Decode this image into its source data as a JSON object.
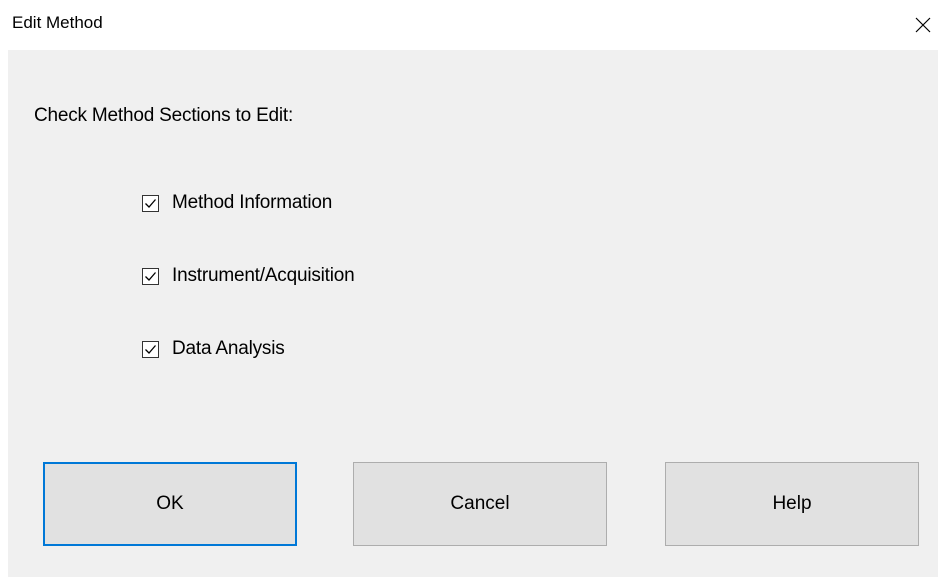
{
  "window": {
    "title": "Edit Method",
    "close_glyph": "✕"
  },
  "dialog": {
    "prompt": "Check Method Sections to Edit:",
    "sections": [
      {
        "label": "Method Information",
        "checked": true
      },
      {
        "label": "Instrument/Acquisition",
        "checked": true
      },
      {
        "label": "Data Analysis",
        "checked": true
      }
    ],
    "buttons": {
      "ok": "OK",
      "cancel": "Cancel",
      "help": "Help"
    }
  },
  "colors": {
    "client_background": "#f0f0f0",
    "button_face": "#e1e1e1",
    "button_border": "#adadad",
    "focus_accent": "#0078d7"
  },
  "icons": {
    "close": "close-icon",
    "checkbox": "checkbox-checked-icon"
  }
}
